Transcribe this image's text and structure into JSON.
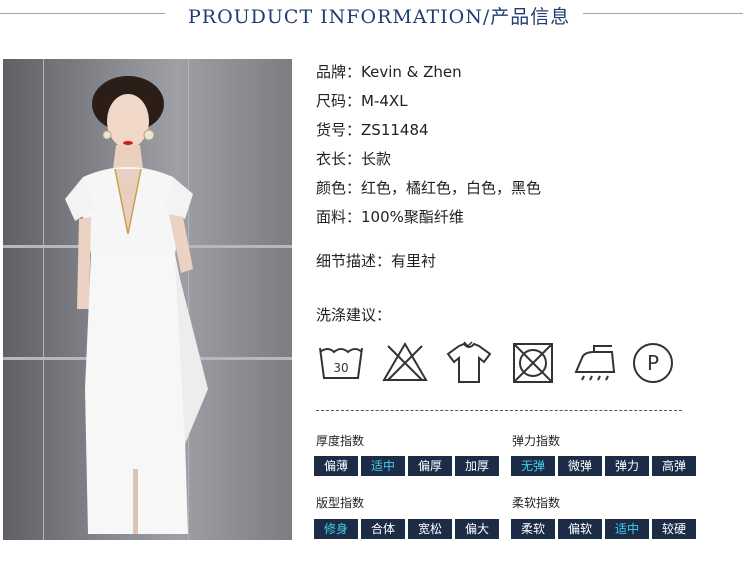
{
  "header": {
    "title": "PROUDUCT INFORMATION/产品信息"
  },
  "photo": {
    "alt": "model in white dress"
  },
  "info": [
    {
      "label": "品牌：",
      "value": "Kevin & Zhen"
    },
    {
      "label": "尺码：",
      "value": "M-4XL"
    },
    {
      "label": "货号：",
      "value": "ZS11484"
    },
    {
      "label": "衣长：",
      "value": "长款"
    },
    {
      "label": "颜色：",
      "value": "红色，橘红色，白色，黑色"
    },
    {
      "label": "面料：",
      "value": "100%聚酯纤维"
    }
  ],
  "detail": "细节描述：有里衬",
  "wash": {
    "title": "洗涤建议：",
    "icons": [
      "wash-30-icon",
      "no-bleach-icon",
      "shirt-icon",
      "no-tumble-dry-icon",
      "iron-icon",
      "dry-clean-p-icon"
    ],
    "temp": "30",
    "p_letter": "P"
  },
  "indices": {
    "thickness": {
      "title": "厚度指数",
      "options": [
        "偏薄",
        "适中",
        "偏厚",
        "加厚"
      ],
      "selected": 1
    },
    "elasticity": {
      "title": "弹力指数",
      "options": [
        "无弹",
        "微弹",
        "弹力",
        "高弹"
      ],
      "selected": 0
    },
    "fit": {
      "title": "版型指数",
      "options": [
        "修身",
        "合体",
        "宽松",
        "偏大"
      ],
      "selected": 0
    },
    "softness": {
      "title": "柔软指数",
      "options": [
        "柔软",
        "偏软",
        "适中",
        "较硬"
      ],
      "selected": 2
    }
  },
  "colors": {
    "title": "#1f3d70",
    "box_bg": "#1c2c47",
    "box_selected_text": "#3fd0ee"
  }
}
